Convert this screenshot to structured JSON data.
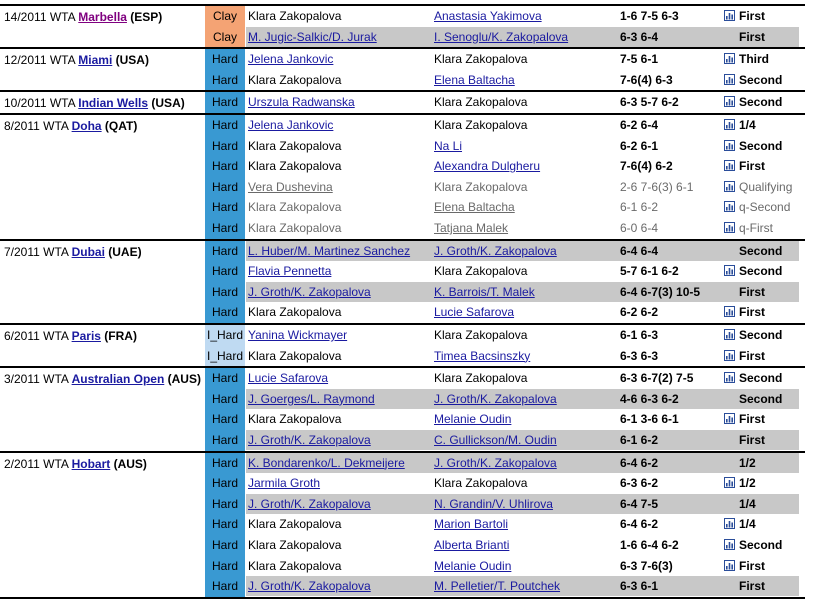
{
  "colors": {
    "clay": "#f4a374",
    "hard": "#3999d2",
    "indoor_hard": "#bfdaf2",
    "doubles_gray": "#c8c8c8",
    "link": "#1a1aa0",
    "visited": "#800080"
  },
  "icon_name": "h2h-bar-chart-icon",
  "tournaments": [
    {
      "prefix": "14/2011 WTA",
      "city": "Marbella",
      "country": "(ESP)",
      "visited": true,
      "rows": [
        {
          "surface": "Clay",
          "p": "Klara Zakopalova",
          "p_link": false,
          "o": "Anastasia Yakimova",
          "o_link": true,
          "score": "1-6 7-5 6-3",
          "icon": true,
          "round": "First",
          "doubles": false,
          "dim": false
        },
        {
          "surface": "Clay",
          "p": "M. Jugic-Salkic/D. Jurak",
          "p_link": true,
          "o": "I. Senoglu/K. Zakopalova",
          "o_link": true,
          "score": "6-3 6-4",
          "icon": false,
          "round": "First",
          "doubles": true,
          "dim": false
        }
      ]
    },
    {
      "prefix": "12/2011 WTA",
      "city": "Miami",
      "country": "(USA)",
      "rows": [
        {
          "surface": "Hard",
          "p": "Jelena Jankovic",
          "p_link": true,
          "o": "Klara Zakopalova",
          "o_link": false,
          "score": "7-5 6-1",
          "icon": true,
          "round": "Third",
          "doubles": false,
          "dim": false
        },
        {
          "surface": "Hard",
          "p": "Klara Zakopalova",
          "p_link": false,
          "o": "Elena Baltacha",
          "o_link": true,
          "score": "7-6(4) 6-3",
          "icon": true,
          "round": "Second",
          "doubles": false,
          "dim": false
        }
      ]
    },
    {
      "prefix": "10/2011 WTA",
      "city": "Indian Wells",
      "country": "(USA)",
      "rows": [
        {
          "surface": "Hard",
          "p": "Urszula Radwanska",
          "p_link": true,
          "o": "Klara Zakopalova",
          "o_link": false,
          "score": "6-3 5-7 6-2",
          "icon": true,
          "round": "Second",
          "doubles": false,
          "dim": false
        }
      ]
    },
    {
      "prefix": "8/2011 WTA",
      "city": "Doha",
      "country": "(QAT)",
      "rows": [
        {
          "surface": "Hard",
          "p": "Jelena Jankovic",
          "p_link": true,
          "o": "Klara Zakopalova",
          "o_link": false,
          "score": "6-2 6-4",
          "icon": true,
          "round": "1/4",
          "doubles": false,
          "dim": false
        },
        {
          "surface": "Hard",
          "p": "Klara Zakopalova",
          "p_link": false,
          "o": "Na Li",
          "o_link": true,
          "score": "6-2 6-1",
          "icon": true,
          "round": "Second",
          "doubles": false,
          "dim": false
        },
        {
          "surface": "Hard",
          "p": "Klara Zakopalova",
          "p_link": false,
          "o": "Alexandra Dulgheru",
          "o_link": true,
          "score": "7-6(4) 6-2",
          "icon": true,
          "round": "First",
          "doubles": false,
          "dim": false
        },
        {
          "surface": "Hard",
          "p": "Vera Dushevina",
          "p_link": true,
          "o": "Klara Zakopalova",
          "o_link": false,
          "score": "2-6 7-6(3) 6-1",
          "icon": true,
          "round": "Qualifying",
          "doubles": false,
          "dim": true
        },
        {
          "surface": "Hard",
          "p": "Klara Zakopalova",
          "p_link": false,
          "o": "Elena Baltacha",
          "o_link": true,
          "score": "6-1 6-2",
          "icon": true,
          "round": "q-Second",
          "doubles": false,
          "dim": true
        },
        {
          "surface": "Hard",
          "p": "Klara Zakopalova",
          "p_link": false,
          "o": "Tatjana Malek",
          "o_link": true,
          "score": "6-0 6-4",
          "icon": true,
          "round": "q-First",
          "doubles": false,
          "dim": true
        }
      ]
    },
    {
      "prefix": "7/2011 WTA",
      "city": "Dubai",
      "country": "(UAE)",
      "rows": [
        {
          "surface": "Hard",
          "p": "L. Huber/M. Martinez Sanchez",
          "p_link": true,
          "o": "J. Groth/K. Zakopalova",
          "o_link": true,
          "score": "6-4 6-4",
          "icon": false,
          "round": "Second",
          "doubles": true,
          "dim": false
        },
        {
          "surface": "Hard",
          "p": "Flavia Pennetta",
          "p_link": true,
          "o": "Klara Zakopalova",
          "o_link": false,
          "score": "5-7 6-1 6-2",
          "icon": true,
          "round": "Second",
          "doubles": false,
          "dim": false
        },
        {
          "surface": "Hard",
          "p": "J. Groth/K. Zakopalova",
          "p_link": true,
          "o": "K. Barrois/T. Malek",
          "o_link": true,
          "score": "6-4 6-7(3) 10-5",
          "icon": false,
          "round": "First",
          "doubles": true,
          "dim": false
        },
        {
          "surface": "Hard",
          "p": "Klara Zakopalova",
          "p_link": false,
          "o": "Lucie Safarova",
          "o_link": true,
          "score": "6-2 6-2",
          "icon": true,
          "round": "First",
          "doubles": false,
          "dim": false
        }
      ]
    },
    {
      "prefix": "6/2011 WTA",
      "city": "Paris",
      "country": "(FRA)",
      "rows": [
        {
          "surface": "I_Hard",
          "p": "Yanina Wickmayer",
          "p_link": true,
          "o": "Klara Zakopalova",
          "o_link": false,
          "score": "6-1 6-3",
          "icon": true,
          "round": "Second",
          "doubles": false,
          "dim": false
        },
        {
          "surface": "I_Hard",
          "p": "Klara Zakopalova",
          "p_link": false,
          "o": "Timea Bacsinszky",
          "o_link": true,
          "score": "6-3 6-3",
          "icon": true,
          "round": "First",
          "doubles": false,
          "dim": false
        }
      ]
    },
    {
      "prefix": "3/2011 WTA",
      "city": "Australian Open",
      "country": "(AUS)",
      "rows": [
        {
          "surface": "Hard",
          "p": "Lucie Safarova",
          "p_link": true,
          "o": "Klara Zakopalova",
          "o_link": false,
          "score": "6-3 6-7(2) 7-5",
          "icon": true,
          "round": "Second",
          "doubles": false,
          "dim": false
        },
        {
          "surface": "Hard",
          "p": "J. Goerges/L. Raymond",
          "p_link": true,
          "o": "J. Groth/K. Zakopalova",
          "o_link": true,
          "score": "4-6 6-3 6-2",
          "icon": false,
          "round": "Second",
          "doubles": true,
          "dim": false
        },
        {
          "surface": "Hard",
          "p": "Klara Zakopalova",
          "p_link": false,
          "o": "Melanie Oudin",
          "o_link": true,
          "score": "6-1 3-6 6-1",
          "icon": true,
          "round": "First",
          "doubles": false,
          "dim": false
        },
        {
          "surface": "Hard",
          "p": "J. Groth/K. Zakopalova",
          "p_link": true,
          "o": "C. Gullickson/M. Oudin",
          "o_link": true,
          "score": "6-1 6-2",
          "icon": false,
          "round": "First",
          "doubles": true,
          "dim": false
        }
      ]
    },
    {
      "prefix": "2/2011 WTA",
      "city": "Hobart",
      "country": "(AUS)",
      "rows": [
        {
          "surface": "Hard",
          "p": "K. Bondarenko/L. Dekmeijere",
          "p_link": true,
          "o": "J. Groth/K. Zakopalova",
          "o_link": true,
          "score": "6-4 6-2",
          "icon": false,
          "round": "1/2",
          "doubles": true,
          "dim": false
        },
        {
          "surface": "Hard",
          "p": "Jarmila Groth",
          "p_link": true,
          "o": "Klara Zakopalova",
          "o_link": false,
          "score": "6-3 6-2",
          "icon": true,
          "round": "1/2",
          "doubles": false,
          "dim": false
        },
        {
          "surface": "Hard",
          "p": "J. Groth/K. Zakopalova",
          "p_link": true,
          "o": "N. Grandin/V. Uhlirova",
          "o_link": true,
          "score": "6-4 7-5",
          "icon": false,
          "round": "1/4",
          "doubles": true,
          "dim": false
        },
        {
          "surface": "Hard",
          "p": "Klara Zakopalova",
          "p_link": false,
          "o": "Marion Bartoli",
          "o_link": true,
          "score": "6-4 6-2",
          "icon": true,
          "round": "1/4",
          "doubles": false,
          "dim": false
        },
        {
          "surface": "Hard",
          "p": "Klara Zakopalova",
          "p_link": false,
          "o": "Alberta Brianti",
          "o_link": true,
          "score": "1-6 6-4 6-2",
          "icon": true,
          "round": "Second",
          "doubles": false,
          "dim": false
        },
        {
          "surface": "Hard",
          "p": "Klara Zakopalova",
          "p_link": false,
          "o": "Melanie Oudin",
          "o_link": true,
          "score": "6-3 7-6(3)",
          "icon": true,
          "round": "First",
          "doubles": false,
          "dim": false
        },
        {
          "surface": "Hard",
          "p": "J. Groth/K. Zakopalova",
          "p_link": true,
          "o": "M. Pelletier/T. Poutchek",
          "o_link": true,
          "score": "6-3 6-1",
          "icon": false,
          "round": "First",
          "doubles": true,
          "dim": false
        }
      ]
    }
  ]
}
